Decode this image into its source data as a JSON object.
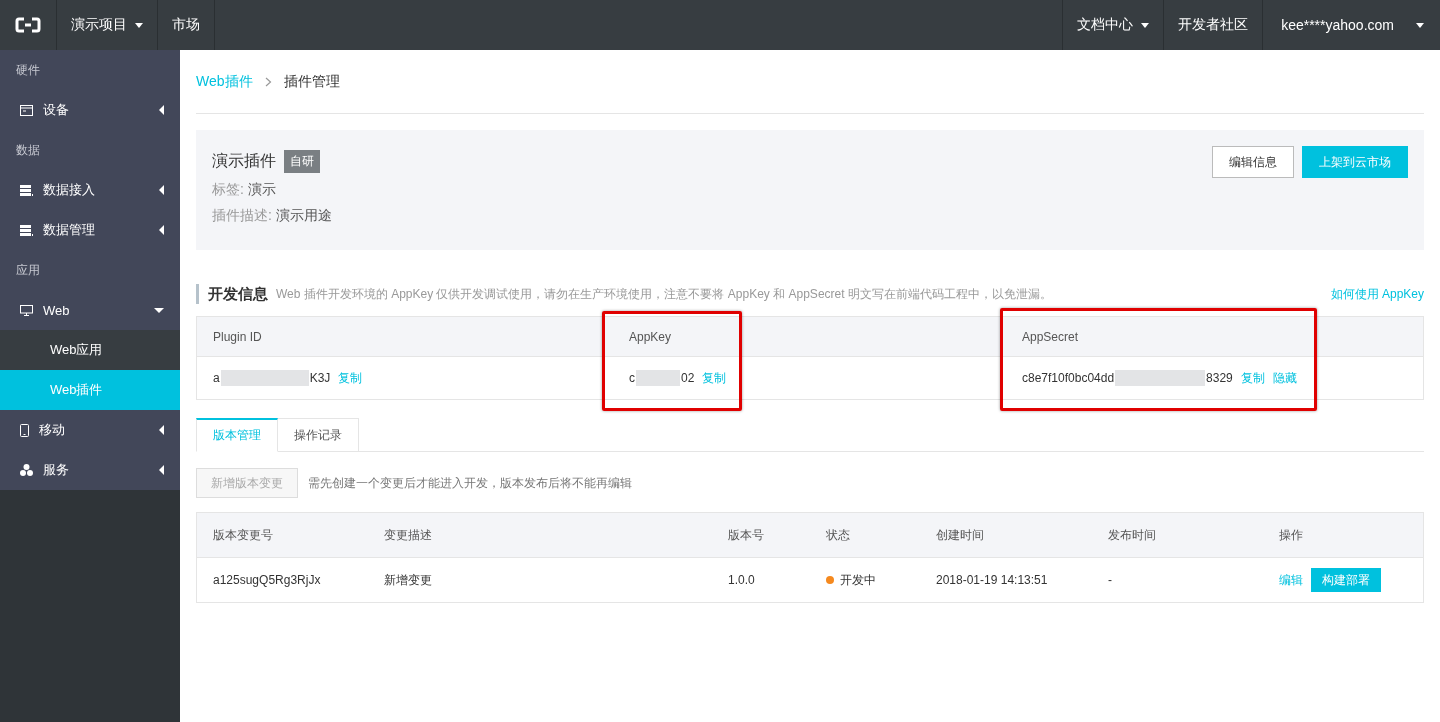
{
  "topbar": {
    "project": "演示项目",
    "market": "市场",
    "docs": "文档中心",
    "community": "开发者社区",
    "account": "kee****yahoo.com"
  },
  "sidebar": [
    {
      "kind": "group",
      "label": "硬件"
    },
    {
      "kind": "item",
      "label": "设备",
      "expanded": false
    },
    {
      "kind": "group",
      "label": "数据"
    },
    {
      "kind": "item",
      "label": "数据接入",
      "expanded": false
    },
    {
      "kind": "item",
      "label": "数据管理",
      "expanded": false
    },
    {
      "kind": "group",
      "label": "应用"
    },
    {
      "kind": "item",
      "label": "Web",
      "expanded": true,
      "children": [
        {
          "label": "Web应用",
          "selected": false
        },
        {
          "label": "Web插件",
          "selected": true
        }
      ]
    },
    {
      "kind": "item",
      "label": "移动",
      "expanded": false
    },
    {
      "kind": "item",
      "label": "服务",
      "expanded": false
    }
  ],
  "breadcrumb": {
    "parent": "Web插件",
    "current": "插件管理"
  },
  "plugin": {
    "name": "演示插件",
    "badge": "自研",
    "tag_label": "标签:",
    "tag": "演示",
    "desc_label": "插件描述:",
    "desc": "演示用途",
    "buttons": [
      {
        "label": "编辑信息",
        "kind": "secondary"
      },
      {
        "label": "上架到云市场",
        "kind": "primary"
      }
    ]
  },
  "dev_info": {
    "title": "开发信息",
    "note": "Web 插件开发环境的 AppKey 仅供开发调试使用，请勿在生产环境使用，注意不要将 AppKey 和 AppSecret 明文写在前端代码工程中，以免泄漏。",
    "help_link": "如何使用 AppKey",
    "columns": [
      "Plugin ID",
      "AppKey",
      "AppSecret"
    ],
    "values": [
      {
        "prefix": "a",
        "suffix": "K3J",
        "actions": [
          "复制"
        ]
      },
      {
        "prefix": "c",
        "suffix": "02",
        "actions": [
          "复制"
        ]
      },
      {
        "prefix": "c8e7f10f0bc04dd",
        "suffix": "8329",
        "actions": [
          "复制",
          "隐藏"
        ]
      }
    ]
  },
  "tabs": [
    {
      "label": "版本管理",
      "selected": true
    },
    {
      "label": "操作记录",
      "selected": false
    }
  ],
  "new_version": {
    "label": "新增版本变更",
    "disabled": true,
    "hint": "需先创建一个变更后才能进入开发，版本发布后将不能再编辑"
  },
  "versions": {
    "columns": [
      "版本变更号",
      "变更描述",
      "版本号",
      "状态",
      "创建时间",
      "发布时间",
      "操作"
    ],
    "rows": [
      {
        "id": "a125sugQ5Rg3RjJx",
        "desc": "新增变更",
        "version": "1.0.0",
        "status": "开发中",
        "color": "#f5891e",
        "created": "2018-01-19 14:13:51",
        "published": "-",
        "edit": "编辑",
        "deploy": "构建部署"
      }
    ]
  }
}
